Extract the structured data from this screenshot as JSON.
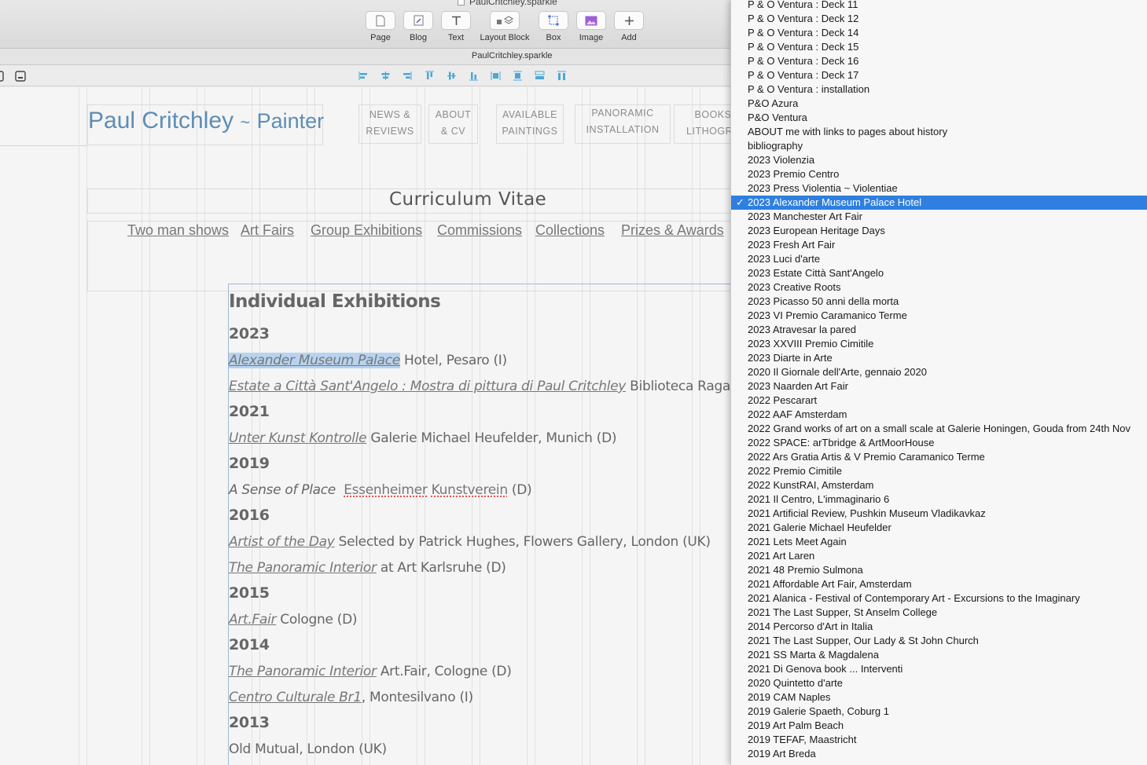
{
  "window": {
    "doc_title": "PaulCritchley.sparkle",
    "path_label": "PaulCritchley.sparkle"
  },
  "toolbar": {
    "tools": [
      {
        "label": "Page",
        "icon": "page-icon"
      },
      {
        "label": "Blog",
        "icon": "blog-icon"
      },
      {
        "label": "Text",
        "icon": "text-icon"
      },
      {
        "label": "Layout Block",
        "icon": "layout-block-icon"
      },
      {
        "label": "Box",
        "icon": "box-icon"
      },
      {
        "label": "Image",
        "icon": "image-icon"
      },
      {
        "label": "Add",
        "icon": "add-icon"
      }
    ]
  },
  "site": {
    "name": "Paul Critchley",
    "tilde": "~",
    "role": "Painter",
    "nav": [
      {
        "line1": "NEWS &",
        "line2": "REVIEWS"
      },
      {
        "line1": "ABOUT",
        "line2": "& CV"
      },
      {
        "line1": "AVAILABLE",
        "line2": "PAINTINGS"
      },
      {
        "line1": "PANORAMIC",
        "line2": "INSTALLATION"
      },
      {
        "line1": "BOOKS",
        "line2": "LITHOGRA"
      }
    ]
  },
  "cv": {
    "title": "Curriculum Vitae",
    "sublinks": [
      "Two man shows",
      "Art Fairs",
      "Group Exhibitions",
      "Commissions",
      "Collections",
      "Prizes & Awards"
    ]
  },
  "content": {
    "heading": "Individual Exhibitions",
    "y2023": "2023",
    "e1_link": "Alexander Museum Palace",
    "e1_rest": " Hotel, Pesaro (I)",
    "e2_link": "Estate a Città Sant'Angelo : Mostra di pittura di Paul Critchley",
    "e2_rest": " Biblioteca Ragazzi, Città",
    "y2021": "2021",
    "e3_link": "Unter Kunst Kontrolle",
    "e3_rest": " Galerie Michael Heufelder, Munich (D)",
    "y2019": "2019",
    "e4_italic": "A Sense of Place",
    "e4_spell1": "Essenheimer",
    "e4_spell2": "Kunstverein",
    "e4_rest": " (D)",
    "y2016": "2016",
    "e5_link": "Artist of the Day",
    "e5_rest": " Selected by Patrick Hughes,  Flowers Gallery, London (UK)",
    "e6_link": "The Panoramic Interior",
    "e6_rest": " at Art Karlsruhe (D)",
    "y2015": "2015",
    "e7_link": "Art.Fair",
    "e7_rest": " Cologne (D)",
    "y2014": "2014",
    "e8_link": "The Panoramic Interior",
    "e8_rest": " Art.Fair, Cologne (D)",
    "e9_link": "Centro Culturale Br1",
    "e9_rest": ", Montesilvano  (I)",
    "y2013": "2013",
    "e10": "Old Mutual, London (UK)"
  },
  "menu": {
    "check": "✓",
    "selected_index": 14,
    "items": [
      "P & O Ventura : Deck 11",
      "P & O Ventura : Deck 12",
      "P & O Ventura : Deck 14",
      "P & O Ventura : Deck 15",
      "P & O Ventura : Deck 16",
      "P & O Ventura : Deck 17",
      "P & O Ventura : installation",
      "P&O Azura",
      "P&O Ventura",
      "ABOUT me with links to pages about history",
      "bibliography",
      "2023 Violenzia",
      "2023 Premio Centro",
      "2023 Press Violentia ~ Violentiae",
      "2023 Alexander Museum Palace Hotel",
      "2023 Manchester Art Fair",
      "2023 European Heritage Days",
      "2023 Fresh Art Fair",
      "2023 Luci d'arte",
      "2023 Estate Città Sant'Angelo",
      "2023 Creative Roots",
      "2023 Picasso 50 anni della morta",
      "2023 VI Premio Caramanico Terme",
      "2023 Atravesar la pared",
      "2023 XXVIII Premio Cimitile",
      "2023 Diarte in Arte",
      "2020 Il Giornale dell'Arte, gennaio 2020",
      "2023 Naarden Art Fair",
      "2022 Pescarart",
      "2022 AAF Amsterdam",
      "2022 Grand works of art on a small scale at Galerie Honingen, Gouda from 24th Nov",
      "2022 SPACE: arTbridge & ArtMoorHouse",
      "2022 Ars Gratia Artis & V Premio Caramanico Terme",
      "2022 Premio Cimitile",
      "2022 KunstRAI, Amsterdam",
      "2021 Il Centro, L'immaginario 6",
      "2021 Artificial Review, Pushkin Museum Vladikavkaz",
      "2021 Galerie Michael Heufelder",
      "2021 Lets Meet Again",
      "2021 Art Laren",
      "2021 48 Premio Sulmona",
      "2021 Affordable Art Fair, Amsterdam",
      "2021 Alanica - Festival of Contemporary Art - Excursions to the Imaginary",
      "2021 The Last Supper, St Anselm College",
      "2014 Percorso d'Art in Italia",
      "2021 The Last Supper, Our Lady & St John Church",
      "2021 SS Marta & Magdalena",
      "2021  Di Genova book ... Interventi",
      "2020 Quintetto d'arte",
      "2019 CAM Naples",
      "2019 Galerie Spaeth, Coburg 1",
      "2019 Art Palm Beach",
      "2019 TEFAF, Maastricht",
      "2019 Art Breda"
    ]
  }
}
